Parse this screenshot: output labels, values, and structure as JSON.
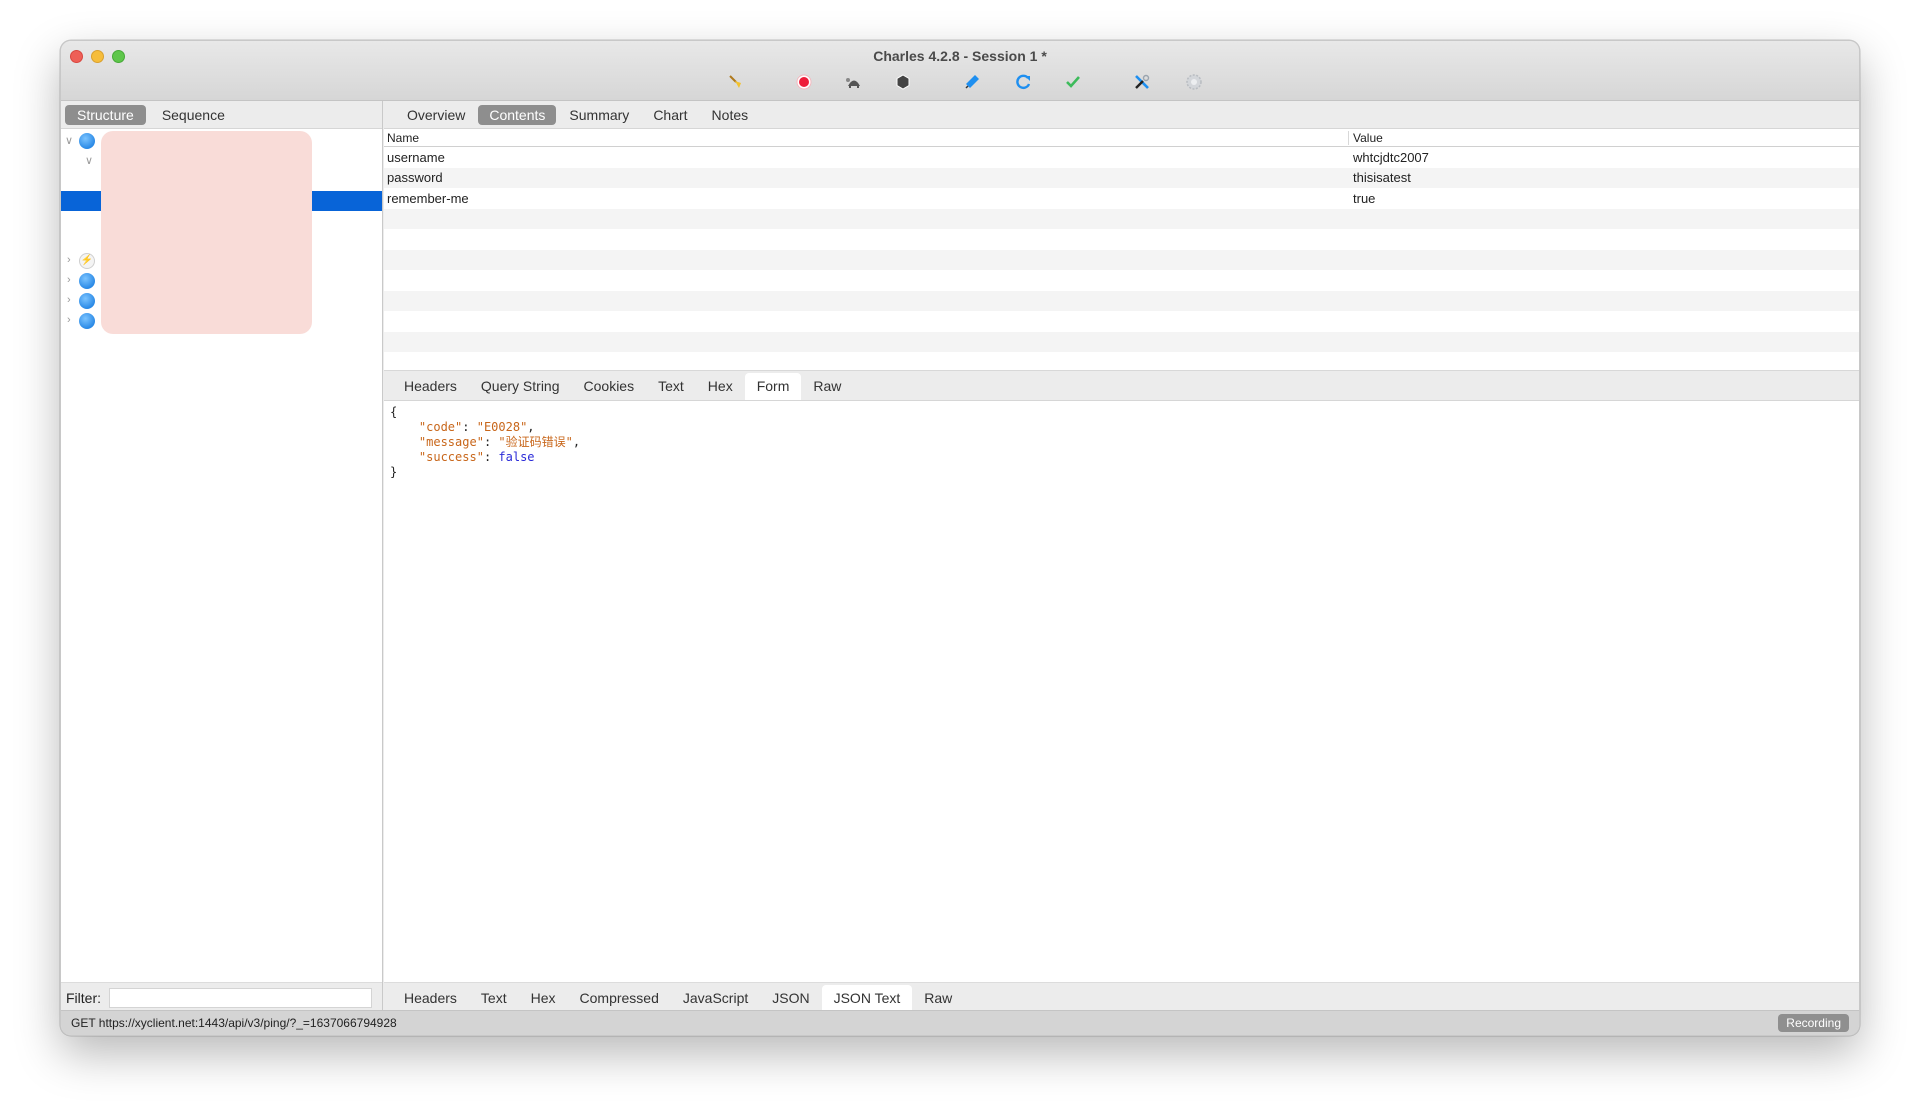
{
  "window": {
    "title": "Charles 4.2.8 - Session 1 *"
  },
  "toolbar": {
    "icons": [
      {
        "name": "broom-icon",
        "label": "Clear Session"
      },
      {
        "name": "record-icon",
        "label": "Record"
      },
      {
        "name": "turtle-throttle-icon",
        "label": "Throttling"
      },
      {
        "name": "breakpoint-hexagon-icon",
        "label": "Breakpoints"
      },
      {
        "name": "pen-compose-icon",
        "label": "Compose"
      },
      {
        "name": "repeat-icon",
        "label": "Repeat"
      },
      {
        "name": "validate-check-icon",
        "label": "Validate"
      },
      {
        "name": "tools-icon",
        "label": "Tools"
      },
      {
        "name": "settings-gear-icon",
        "label": "Settings"
      }
    ]
  },
  "left": {
    "tabs": [
      {
        "label": "Structure",
        "active": true
      },
      {
        "label": "Sequence",
        "active": false
      }
    ],
    "tree": [
      {
        "type": "globe",
        "expanded": true,
        "depth": 0
      },
      {
        "type": "folder",
        "expanded": true,
        "depth": 1
      },
      {
        "type": "blank",
        "depth": 2
      },
      {
        "type": "selected",
        "depth": 2
      },
      {
        "type": "blank",
        "depth": 2
      },
      {
        "type": "blank",
        "depth": 2
      },
      {
        "type": "bolt",
        "expanded": false,
        "depth": 0
      },
      {
        "type": "globe",
        "expanded": false,
        "depth": 0
      },
      {
        "type": "globe",
        "expanded": false,
        "depth": 0
      },
      {
        "type": "globe",
        "expanded": false,
        "depth": 0
      }
    ],
    "filter": {
      "label": "Filter:",
      "value": ""
    }
  },
  "main": {
    "tabs": [
      {
        "label": "Overview",
        "active": false
      },
      {
        "label": "Contents",
        "active": true
      },
      {
        "label": "Summary",
        "active": false
      },
      {
        "label": "Chart",
        "active": false
      },
      {
        "label": "Notes",
        "active": false
      }
    ],
    "form_table": {
      "columns": [
        "Name",
        "Value"
      ],
      "rows": [
        {
          "name": "username",
          "value": "whtcjdtc2007"
        },
        {
          "name": "password",
          "value": "thisisatest"
        },
        {
          "name": "remember-me",
          "value": "true"
        }
      ]
    },
    "request_tabs": [
      {
        "label": "Headers",
        "active": false
      },
      {
        "label": "Query String",
        "active": false
      },
      {
        "label": "Cookies",
        "active": false
      },
      {
        "label": "Text",
        "active": false
      },
      {
        "label": "Hex",
        "active": false
      },
      {
        "label": "Form",
        "active": true
      },
      {
        "label": "Raw",
        "active": false
      }
    ],
    "response_json": {
      "open": "{",
      "close": "}",
      "entries": [
        {
          "key": "\"code\"",
          "value": "\"E0028\"",
          "kind": "string",
          "trailing": ","
        },
        {
          "key": "\"message\"",
          "value": "\"验证码错误\"",
          "kind": "string",
          "trailing": ","
        },
        {
          "key": "\"success\"",
          "value": "false",
          "kind": "bool",
          "trailing": ""
        }
      ]
    },
    "response_tabs": [
      {
        "label": "Headers",
        "active": false
      },
      {
        "label": "Text",
        "active": false
      },
      {
        "label": "Hex",
        "active": false
      },
      {
        "label": "Compressed",
        "active": false
      },
      {
        "label": "JavaScript",
        "active": false
      },
      {
        "label": "JSON",
        "active": false
      },
      {
        "label": "JSON Text",
        "active": true
      },
      {
        "label": "Raw",
        "active": false
      }
    ]
  },
  "status": {
    "text": "GET https://xyclient.net:1443/api/v3/ping/?_=1637066794928",
    "recording_label": "Recording"
  },
  "colors": {
    "selection": "#0864d8",
    "json_string": "#c8661a",
    "json_bool": "#2a2ad8",
    "redaction": "#f9dcd8"
  }
}
